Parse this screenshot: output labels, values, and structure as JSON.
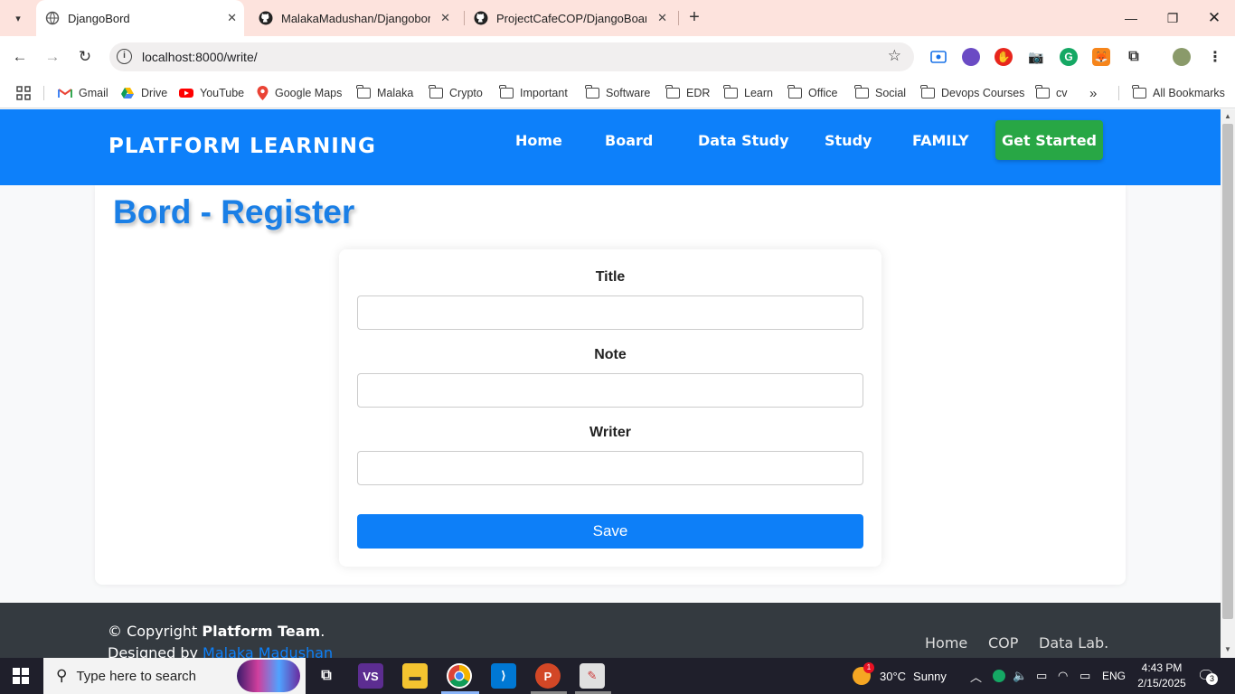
{
  "browser": {
    "tabs": [
      {
        "title": "DjangoBord",
        "active": true
      },
      {
        "title": "MalakaMadushan/Djangobord: ",
        "active": false
      },
      {
        "title": "ProjectCafeCOP/DjangoBoard/t",
        "active": false
      }
    ],
    "url": "localhost:8000/write/",
    "bookmarks": [
      {
        "label": "Gmail",
        "icon": "gmail-icon"
      },
      {
        "label": "Drive",
        "icon": "drive-icon"
      },
      {
        "label": "YouTube",
        "icon": "youtube-icon"
      },
      {
        "label": "Google Maps",
        "icon": "maps-icon"
      },
      {
        "label": "Malaka",
        "icon": "folder-icon"
      },
      {
        "label": "Crypto",
        "icon": "folder-icon"
      },
      {
        "label": "Important",
        "icon": "folder-icon"
      },
      {
        "label": "Software",
        "icon": "folder-icon"
      },
      {
        "label": "EDR",
        "icon": "folder-icon"
      },
      {
        "label": "Learn",
        "icon": "folder-icon"
      },
      {
        "label": "Office",
        "icon": "folder-icon"
      },
      {
        "label": "Social",
        "icon": "folder-icon"
      },
      {
        "label": "Devops Courses",
        "icon": "folder-icon"
      },
      {
        "label": "cv",
        "icon": "folder-icon"
      }
    ],
    "overflow": "»",
    "all_bookmarks": "All Bookmarks"
  },
  "site": {
    "brand": "PLATFORM LEARNING",
    "nav": [
      "Home",
      "Board",
      "Data Study",
      "Study",
      "FAMILY"
    ],
    "cta": "Get Started",
    "accent": "#0d80fa",
    "cta_color": "#28a745"
  },
  "page": {
    "title": "Bord - Register",
    "form": {
      "fields": [
        {
          "label": "Title",
          "value": ""
        },
        {
          "label": "Note",
          "value": ""
        },
        {
          "label": "Writer",
          "value": ""
        }
      ],
      "submit": "Save"
    }
  },
  "footer": {
    "copyright_prefix": "© Copyright ",
    "team": "Platform Team",
    "period": ".",
    "designed_by": "Designed by ",
    "author": "Malaka Madushan",
    "links": [
      "Home",
      "COP",
      "Data Lab."
    ]
  },
  "taskbar": {
    "search_placeholder": "Type here to search",
    "weather_temp": "30°C",
    "weather_text": "Sunny",
    "weather_badge": "1",
    "language": "ENG",
    "time": "4:43 PM",
    "date": "2/15/2025",
    "notifications": "3"
  }
}
